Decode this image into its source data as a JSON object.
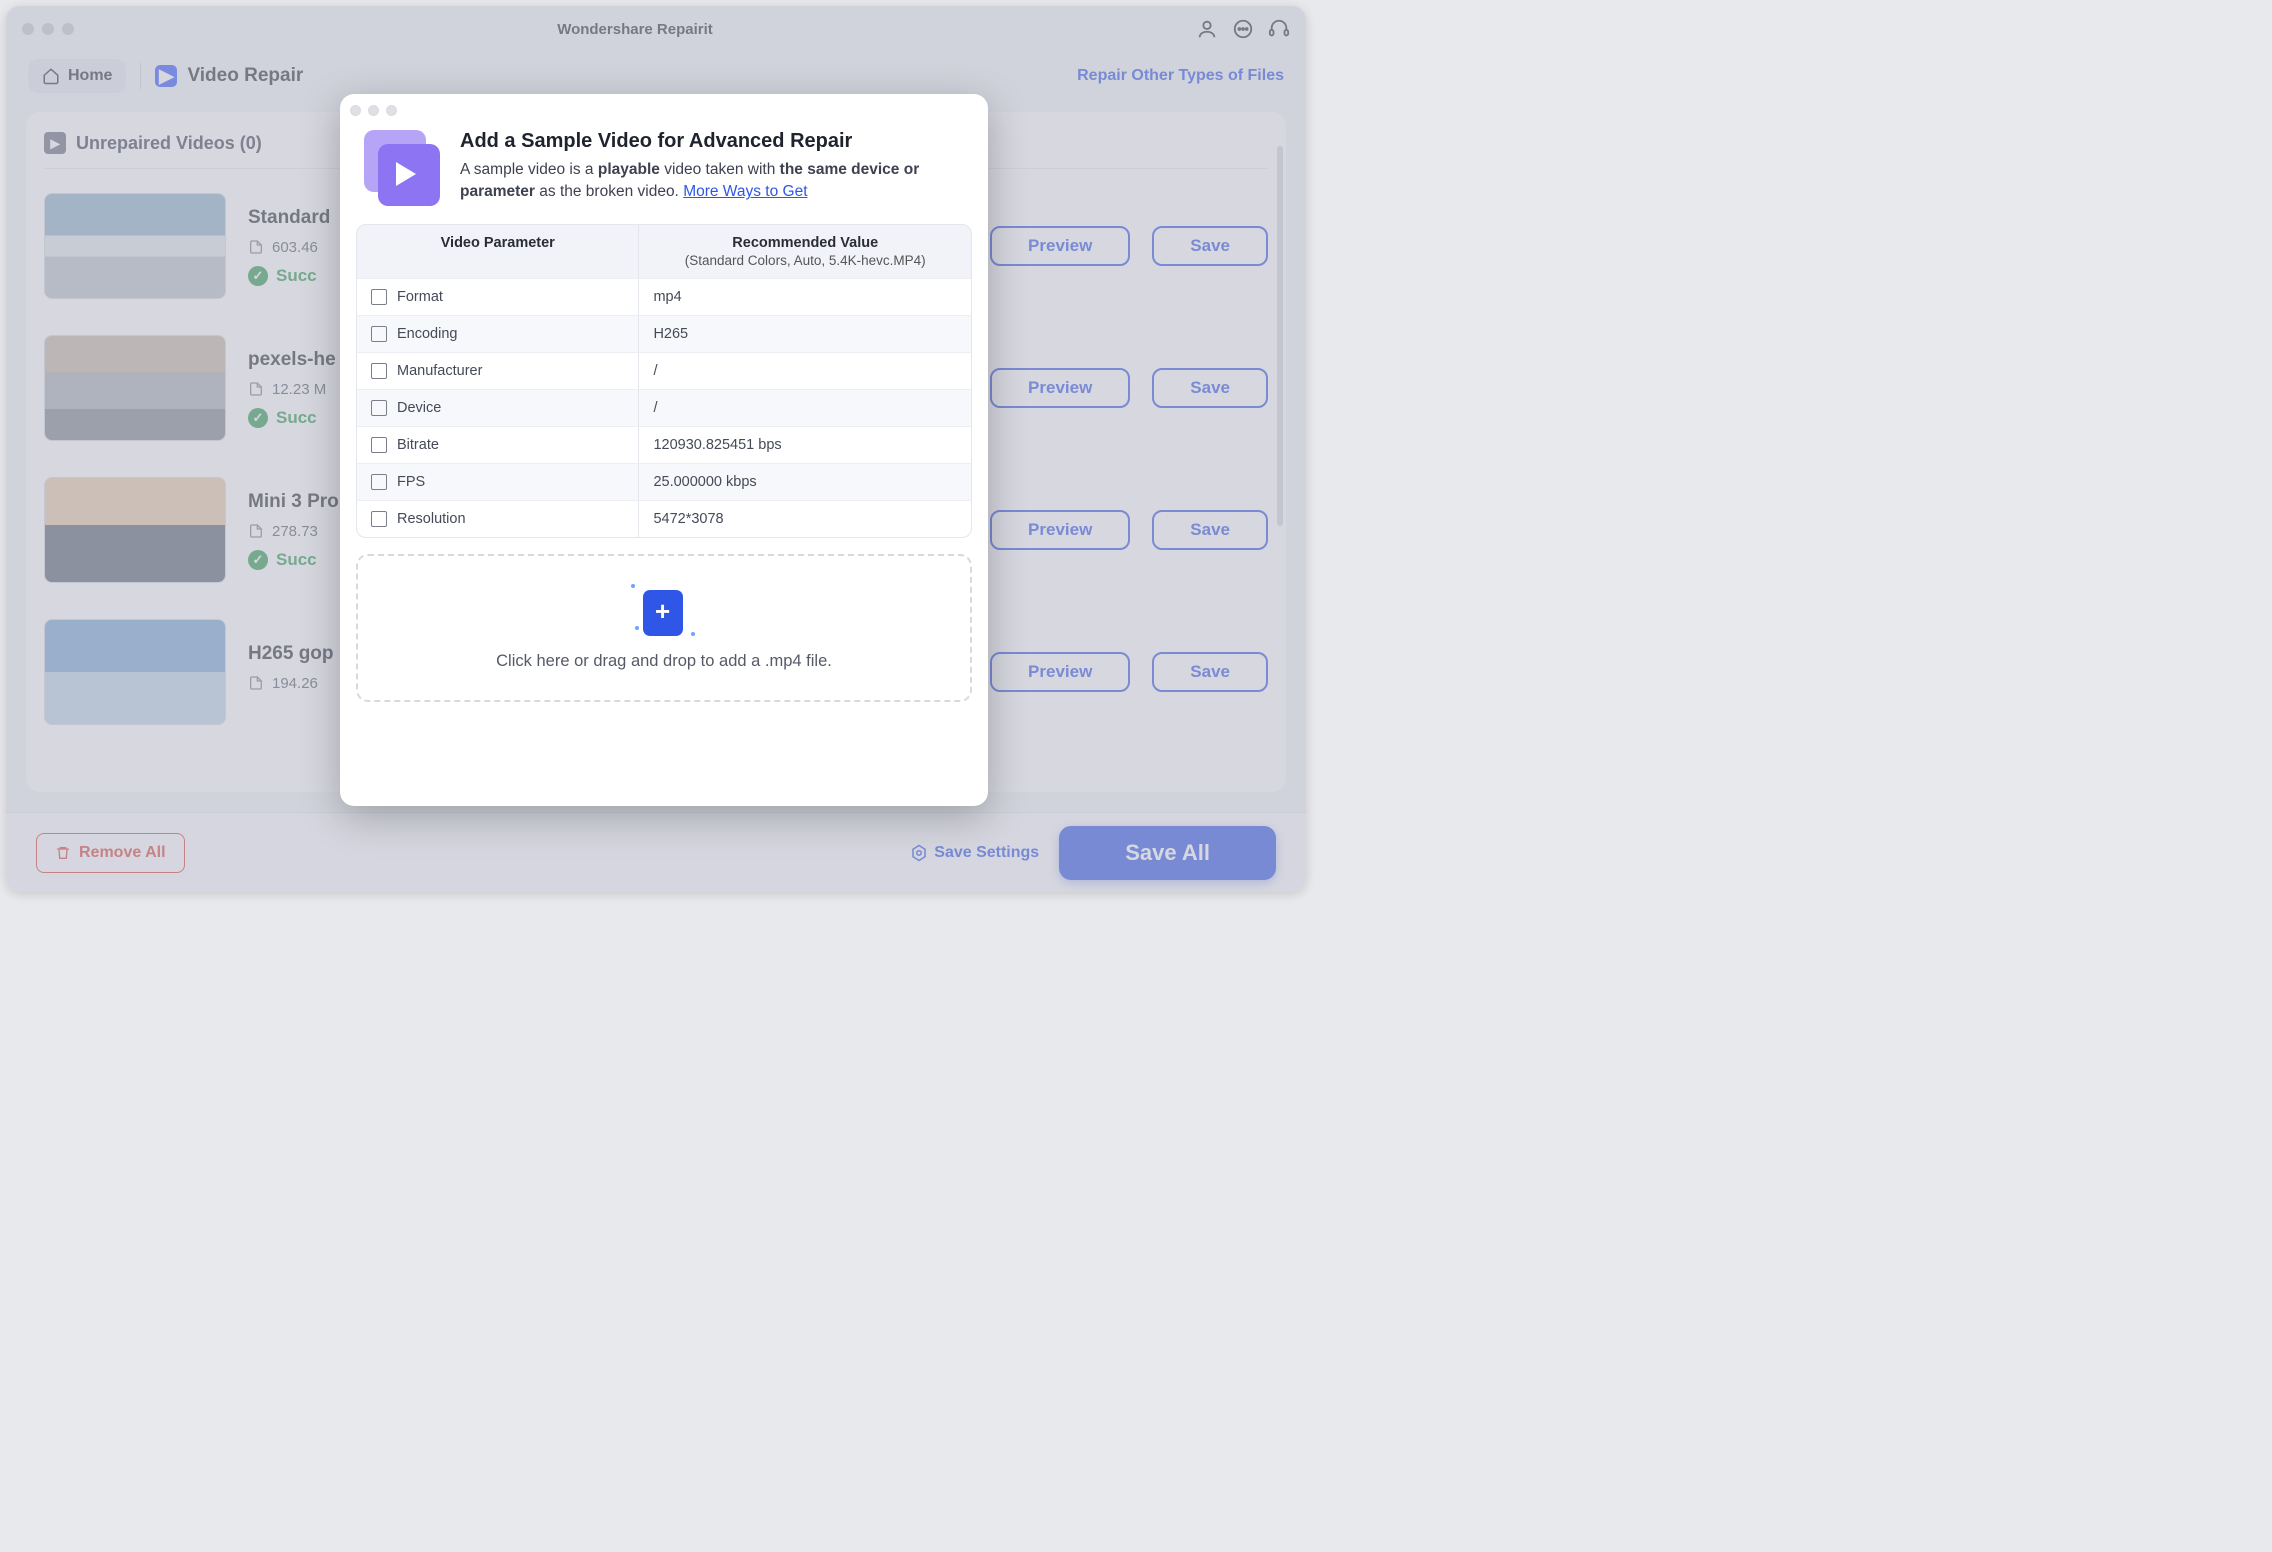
{
  "app_title": "Wondershare Repairit",
  "toolbar": {
    "home_label": "Home",
    "section_label": "Video Repair",
    "repair_other_link": "Repair Other Types of Files"
  },
  "panel": {
    "heading": "Unrepaired Videos (0)"
  },
  "items": [
    {
      "name": "Standard",
      "size": "603.46",
      "status": "Succ",
      "preview": "Preview",
      "save": "Save"
    },
    {
      "name": "pexels-he",
      "size": "12.23 M",
      "status": "Succ",
      "preview": "Preview",
      "save": "Save"
    },
    {
      "name": "Mini 3 Pro",
      "size": "278.73",
      "status": "Succ",
      "preview": "Preview",
      "save": "Save"
    },
    {
      "name": "H265 gop",
      "size": "194.26",
      "status": "",
      "preview": "Preview",
      "save": "Save"
    }
  ],
  "footer": {
    "remove_all": "Remove All",
    "save_settings": "Save Settings",
    "save_all": "Save All"
  },
  "modal": {
    "title": "Add a Sample Video for Advanced Repair",
    "desc_pre": "A sample video is a ",
    "desc_b1": "playable",
    "desc_mid": " video taken with ",
    "desc_b2": "the same device or parameter",
    "desc_post": " as the broken video. ",
    "link": "More Ways to Get",
    "table": {
      "head_param": "Video Parameter",
      "head_value": "Recommended Value",
      "head_sub": "(Standard Colors, Auto, 5.4K-hevc.MP4)",
      "rows": [
        {
          "label": "Format",
          "value": "mp4"
        },
        {
          "label": "Encoding",
          "value": "H265"
        },
        {
          "label": "Manufacturer",
          "value": "/"
        },
        {
          "label": "Device",
          "value": "/"
        },
        {
          "label": "Bitrate",
          "value": "120930.825451 bps"
        },
        {
          "label": "FPS",
          "value": "25.000000 kbps"
        },
        {
          "label": "Resolution",
          "value": "5472*3078"
        }
      ]
    },
    "dropzone": "Click here or drag and drop to add a .mp4 file."
  }
}
